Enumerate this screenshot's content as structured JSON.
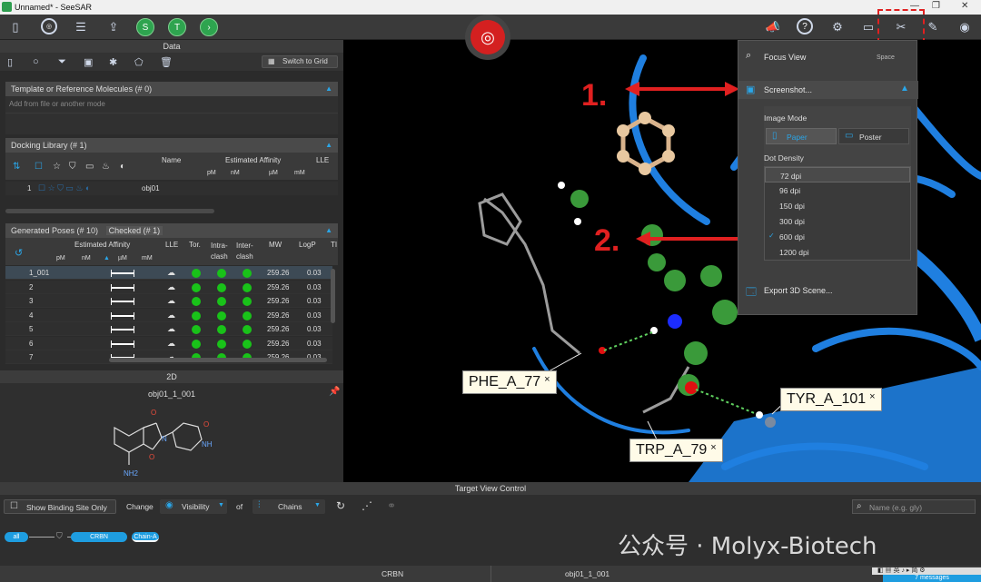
{
  "window": {
    "title": "Unnamed* - SeeSAR"
  },
  "data_panel": {
    "title": "Data",
    "switch_label": "Switch to Grid",
    "template_header": "Template or Reference Molecules (# 0)",
    "template_placeholder": "Add from file or another mode",
    "docking_header": "Docking Library (# 1)",
    "docking_columns": {
      "name": "Name",
      "affinity": "Estimated Affinity",
      "lle": "LLE",
      "units": [
        "pM",
        "nM",
        "µM",
        "mM"
      ]
    },
    "docking_rows": [
      {
        "index": "1",
        "name": "obj01"
      }
    ],
    "poses_header": "Generated Poses (# 10)",
    "poses_checked": "Checked (# 1)",
    "poses_columns": {
      "affinity": "Estimated Affinity",
      "lle": "LLE",
      "tor": "Tor.",
      "intra": "Intra-clash",
      "inter": "Inter-clash",
      "mw": "MW",
      "logp": "LogP",
      "ti": "TI",
      "units": [
        "pM",
        "nM",
        "µM",
        "mM"
      ]
    },
    "poses_rows": [
      {
        "id": "1_001",
        "mw": "259.26",
        "logp": "0.03"
      },
      {
        "id": "2",
        "mw": "259.26",
        "logp": "0.03"
      },
      {
        "id": "3",
        "mw": "259.26",
        "logp": "0.03"
      },
      {
        "id": "4",
        "mw": "259.26",
        "logp": "0.03"
      },
      {
        "id": "5",
        "mw": "259.26",
        "logp": "0.03"
      },
      {
        "id": "6",
        "mw": "259.26",
        "logp": "0.03"
      },
      {
        "id": "7",
        "mw": "259.26",
        "logp": "0.03"
      }
    ]
  },
  "panel_2d": {
    "title": "2D",
    "molecule_name": "obj01_1_001",
    "atoms": {
      "o1": "O",
      "o2": "O",
      "o3": "O",
      "nh": "NH",
      "n": "N",
      "nh2": "NH2"
    }
  },
  "menu": {
    "focus_view": "Focus View",
    "focus_shortcut": "Space",
    "screenshot": "Screenshot...",
    "image_mode_label": "Image Mode",
    "mode_paper": "Paper",
    "mode_poster": "Poster",
    "dot_density_label": "Dot Density",
    "dpi_options": [
      "72 dpi",
      "96 dpi",
      "150 dpi",
      "300 dpi",
      "600 dpi",
      "1200 dpi"
    ],
    "dpi_selected": "600 dpi",
    "export_3d": "Export 3D Scene..."
  },
  "annotations": {
    "step1": "1.",
    "step2": "2."
  },
  "residue_labels": [
    "PHE_A_77",
    "TYR_A_101",
    "TRP_A_79"
  ],
  "target_view": {
    "title": "Target View Control",
    "show_binding": "Show Binding Site Only",
    "change": "Change",
    "visibility": "Visibility",
    "of": "of",
    "chains": "Chains",
    "search_placeholder": "Name (e.g. gly)",
    "tree_all": "all",
    "tree_crbn": "CRBN",
    "tree_chain": "Chain-A"
  },
  "status": {
    "target": "CRBN",
    "pose": "obj01_1_001",
    "messages": "7 messages"
  },
  "watermark": "公众号 · Molyx-Biotech"
}
